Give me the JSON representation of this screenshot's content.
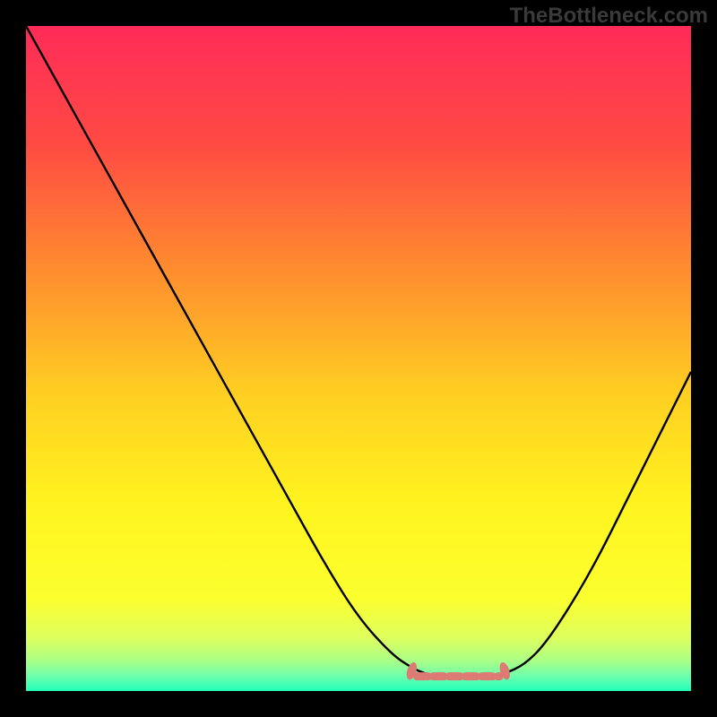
{
  "watermark": "TheBottleneck.com",
  "chart_data": {
    "type": "line",
    "title": "",
    "xlabel": "",
    "ylabel": "",
    "xlim": [
      0,
      100
    ],
    "ylim": [
      0,
      100
    ],
    "series": [
      {
        "name": "curve",
        "color": "#000000",
        "x": [
          0,
          5,
          10,
          15,
          20,
          25,
          30,
          35,
          40,
          45,
          50,
          55,
          58,
          60,
          62,
          65,
          68,
          70,
          72,
          75,
          78,
          82,
          86,
          90,
          94,
          98,
          100
        ],
        "y": [
          100,
          91,
          82,
          73,
          64,
          55,
          46,
          37,
          28,
          19,
          11,
          5.5,
          3.5,
          2.6,
          2.2,
          2.0,
          2.0,
          2.2,
          2.6,
          4.0,
          7,
          13,
          20,
          28,
          36,
          44,
          48
        ]
      }
    ],
    "highlight_band": {
      "color": "#dd7a74",
      "x_from": 58,
      "x_to": 72,
      "y_approx": 2.2
    },
    "background_gradient": {
      "stops": [
        {
          "offset": 0.0,
          "color": "#ff2b58"
        },
        {
          "offset": 0.18,
          "color": "#ff4b43"
        },
        {
          "offset": 0.36,
          "color": "#ff8a2f"
        },
        {
          "offset": 0.55,
          "color": "#ffce22"
        },
        {
          "offset": 0.72,
          "color": "#fff41f"
        },
        {
          "offset": 0.86,
          "color": "#fcff2e"
        },
        {
          "offset": 0.92,
          "color": "#deff5e"
        },
        {
          "offset": 0.955,
          "color": "#a9ff87"
        },
        {
          "offset": 0.978,
          "color": "#6dffad"
        },
        {
          "offset": 1.0,
          "color": "#22ffb8"
        }
      ]
    }
  }
}
